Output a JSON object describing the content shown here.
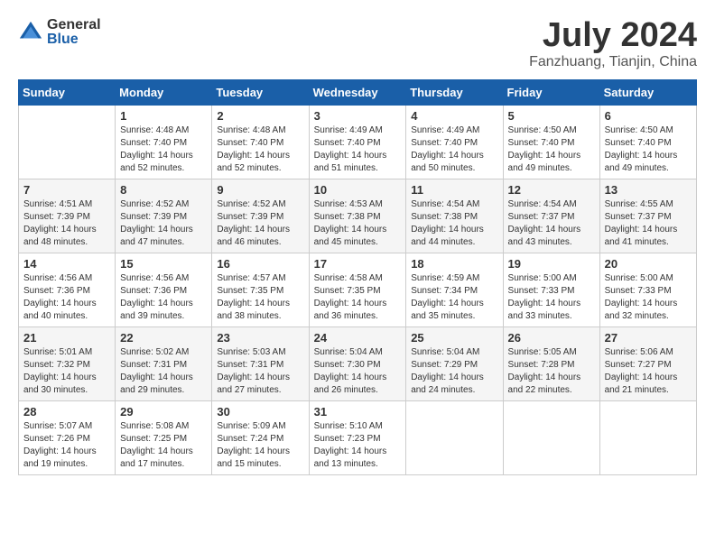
{
  "header": {
    "logo": {
      "general": "General",
      "blue": "Blue"
    },
    "title": "July 2024",
    "location": "Fanzhuang, Tianjin, China"
  },
  "weekdays": [
    "Sunday",
    "Monday",
    "Tuesday",
    "Wednesday",
    "Thursday",
    "Friday",
    "Saturday"
  ],
  "weeks": [
    [
      {
        "day": "",
        "sunrise": "",
        "sunset": "",
        "daylight": ""
      },
      {
        "day": "1",
        "sunrise": "Sunrise: 4:48 AM",
        "sunset": "Sunset: 7:40 PM",
        "daylight": "Daylight: 14 hours and 52 minutes."
      },
      {
        "day": "2",
        "sunrise": "Sunrise: 4:48 AM",
        "sunset": "Sunset: 7:40 PM",
        "daylight": "Daylight: 14 hours and 52 minutes."
      },
      {
        "day": "3",
        "sunrise": "Sunrise: 4:49 AM",
        "sunset": "Sunset: 7:40 PM",
        "daylight": "Daylight: 14 hours and 51 minutes."
      },
      {
        "day": "4",
        "sunrise": "Sunrise: 4:49 AM",
        "sunset": "Sunset: 7:40 PM",
        "daylight": "Daylight: 14 hours and 50 minutes."
      },
      {
        "day": "5",
        "sunrise": "Sunrise: 4:50 AM",
        "sunset": "Sunset: 7:40 PM",
        "daylight": "Daylight: 14 hours and 49 minutes."
      },
      {
        "day": "6",
        "sunrise": "Sunrise: 4:50 AM",
        "sunset": "Sunset: 7:40 PM",
        "daylight": "Daylight: 14 hours and 49 minutes."
      }
    ],
    [
      {
        "day": "7",
        "sunrise": "Sunrise: 4:51 AM",
        "sunset": "Sunset: 7:39 PM",
        "daylight": "Daylight: 14 hours and 48 minutes."
      },
      {
        "day": "8",
        "sunrise": "Sunrise: 4:52 AM",
        "sunset": "Sunset: 7:39 PM",
        "daylight": "Daylight: 14 hours and 47 minutes."
      },
      {
        "day": "9",
        "sunrise": "Sunrise: 4:52 AM",
        "sunset": "Sunset: 7:39 PM",
        "daylight": "Daylight: 14 hours and 46 minutes."
      },
      {
        "day": "10",
        "sunrise": "Sunrise: 4:53 AM",
        "sunset": "Sunset: 7:38 PM",
        "daylight": "Daylight: 14 hours and 45 minutes."
      },
      {
        "day": "11",
        "sunrise": "Sunrise: 4:54 AM",
        "sunset": "Sunset: 7:38 PM",
        "daylight": "Daylight: 14 hours and 44 minutes."
      },
      {
        "day": "12",
        "sunrise": "Sunrise: 4:54 AM",
        "sunset": "Sunset: 7:37 PM",
        "daylight": "Daylight: 14 hours and 43 minutes."
      },
      {
        "day": "13",
        "sunrise": "Sunrise: 4:55 AM",
        "sunset": "Sunset: 7:37 PM",
        "daylight": "Daylight: 14 hours and 41 minutes."
      }
    ],
    [
      {
        "day": "14",
        "sunrise": "Sunrise: 4:56 AM",
        "sunset": "Sunset: 7:36 PM",
        "daylight": "Daylight: 14 hours and 40 minutes."
      },
      {
        "day": "15",
        "sunrise": "Sunrise: 4:56 AM",
        "sunset": "Sunset: 7:36 PM",
        "daylight": "Daylight: 14 hours and 39 minutes."
      },
      {
        "day": "16",
        "sunrise": "Sunrise: 4:57 AM",
        "sunset": "Sunset: 7:35 PM",
        "daylight": "Daylight: 14 hours and 38 minutes."
      },
      {
        "day": "17",
        "sunrise": "Sunrise: 4:58 AM",
        "sunset": "Sunset: 7:35 PM",
        "daylight": "Daylight: 14 hours and 36 minutes."
      },
      {
        "day": "18",
        "sunrise": "Sunrise: 4:59 AM",
        "sunset": "Sunset: 7:34 PM",
        "daylight": "Daylight: 14 hours and 35 minutes."
      },
      {
        "day": "19",
        "sunrise": "Sunrise: 5:00 AM",
        "sunset": "Sunset: 7:33 PM",
        "daylight": "Daylight: 14 hours and 33 minutes."
      },
      {
        "day": "20",
        "sunrise": "Sunrise: 5:00 AM",
        "sunset": "Sunset: 7:33 PM",
        "daylight": "Daylight: 14 hours and 32 minutes."
      }
    ],
    [
      {
        "day": "21",
        "sunrise": "Sunrise: 5:01 AM",
        "sunset": "Sunset: 7:32 PM",
        "daylight": "Daylight: 14 hours and 30 minutes."
      },
      {
        "day": "22",
        "sunrise": "Sunrise: 5:02 AM",
        "sunset": "Sunset: 7:31 PM",
        "daylight": "Daylight: 14 hours and 29 minutes."
      },
      {
        "day": "23",
        "sunrise": "Sunrise: 5:03 AM",
        "sunset": "Sunset: 7:31 PM",
        "daylight": "Daylight: 14 hours and 27 minutes."
      },
      {
        "day": "24",
        "sunrise": "Sunrise: 5:04 AM",
        "sunset": "Sunset: 7:30 PM",
        "daylight": "Daylight: 14 hours and 26 minutes."
      },
      {
        "day": "25",
        "sunrise": "Sunrise: 5:04 AM",
        "sunset": "Sunset: 7:29 PM",
        "daylight": "Daylight: 14 hours and 24 minutes."
      },
      {
        "day": "26",
        "sunrise": "Sunrise: 5:05 AM",
        "sunset": "Sunset: 7:28 PM",
        "daylight": "Daylight: 14 hours and 22 minutes."
      },
      {
        "day": "27",
        "sunrise": "Sunrise: 5:06 AM",
        "sunset": "Sunset: 7:27 PM",
        "daylight": "Daylight: 14 hours and 21 minutes."
      }
    ],
    [
      {
        "day": "28",
        "sunrise": "Sunrise: 5:07 AM",
        "sunset": "Sunset: 7:26 PM",
        "daylight": "Daylight: 14 hours and 19 minutes."
      },
      {
        "day": "29",
        "sunrise": "Sunrise: 5:08 AM",
        "sunset": "Sunset: 7:25 PM",
        "daylight": "Daylight: 14 hours and 17 minutes."
      },
      {
        "day": "30",
        "sunrise": "Sunrise: 5:09 AM",
        "sunset": "Sunset: 7:24 PM",
        "daylight": "Daylight: 14 hours and 15 minutes."
      },
      {
        "day": "31",
        "sunrise": "Sunrise: 5:10 AM",
        "sunset": "Sunset: 7:23 PM",
        "daylight": "Daylight: 14 hours and 13 minutes."
      },
      {
        "day": "",
        "sunrise": "",
        "sunset": "",
        "daylight": ""
      },
      {
        "day": "",
        "sunrise": "",
        "sunset": "",
        "daylight": ""
      },
      {
        "day": "",
        "sunrise": "",
        "sunset": "",
        "daylight": ""
      }
    ]
  ]
}
